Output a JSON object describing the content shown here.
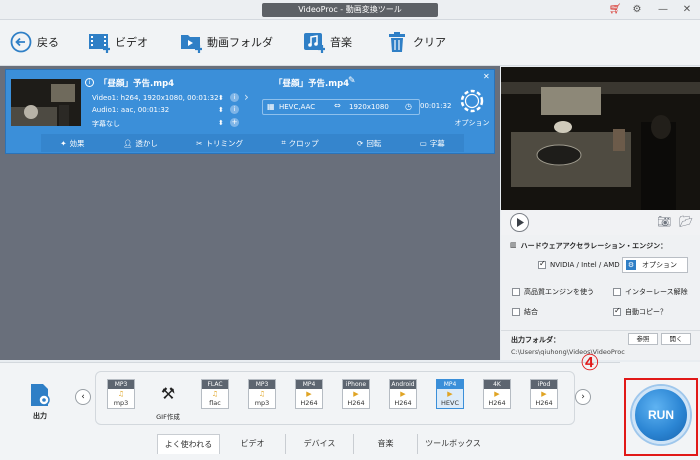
{
  "window": {
    "title": "VideoProc - 動画変換ツール"
  },
  "toolbar": {
    "back": "戻る",
    "video": "ビデオ",
    "folder": "動画フォルダ",
    "music": "音楽",
    "clear": "クリア"
  },
  "item": {
    "source_name": "「昼顔」予告.mp4",
    "video_info": "Video1: h264, 1920x1080, 00:01:32",
    "audio_info": "Audio1: aac, 00:01:32",
    "subtitle": "字幕なし",
    "output_name": "「昼顔」予告.mp4",
    "codec": "HEVC,AAC",
    "resolution": "1920x1080",
    "duration": "00:01:32",
    "option_label": "オプション",
    "codec_gear": "codec",
    "tools": [
      "効果",
      "透かし",
      "トリミング",
      "クロップ",
      "回転",
      "字幕"
    ]
  },
  "hardware": {
    "heading": "ハードウェアアクセラレーション・エンジン：",
    "gpu_label": "NVIDIA / Intel / AMD",
    "option_button": "オプション",
    "hq_engine": "高品質エンジンを使う",
    "deinterlace": "インターレース解除",
    "merge": "結合",
    "autocopy": "自動コピー？"
  },
  "output_folder": {
    "label": "出力フォルダ：",
    "browse": "参照",
    "open": "開く",
    "path": "C:\\Users\\qiuhong\\Videos\\VideoProc"
  },
  "output_label": "出力",
  "formats": [
    {
      "top": "MP3",
      "sub": "mp3",
      "kind": "audio"
    },
    {
      "top": "",
      "sub": "GIF作成",
      "kind": "gif"
    },
    {
      "top": "FLAC",
      "sub": "flac",
      "kind": "audio"
    },
    {
      "top": "MP3",
      "sub": "mp3",
      "kind": "audio"
    },
    {
      "top": "MP4",
      "sub": "H264",
      "kind": "video"
    },
    {
      "top": "iPhone",
      "sub": "H264",
      "kind": "video"
    },
    {
      "top": "Android",
      "sub": "H264",
      "kind": "video"
    },
    {
      "top": "MP4",
      "sub": "HEVC",
      "kind": "video",
      "selected": true
    },
    {
      "top": "4K",
      "sub": "H264",
      "kind": "video"
    },
    {
      "top": "iPod",
      "sub": "H264",
      "kind": "video"
    }
  ],
  "tabs": [
    "よく使われる",
    "ビデオ",
    "デバイス",
    "音楽",
    "ツールボックス"
  ],
  "annotation": "④",
  "run_button": "RUN",
  "colors": {
    "accent": "#3b8fd9",
    "highlight": "#e11818"
  }
}
